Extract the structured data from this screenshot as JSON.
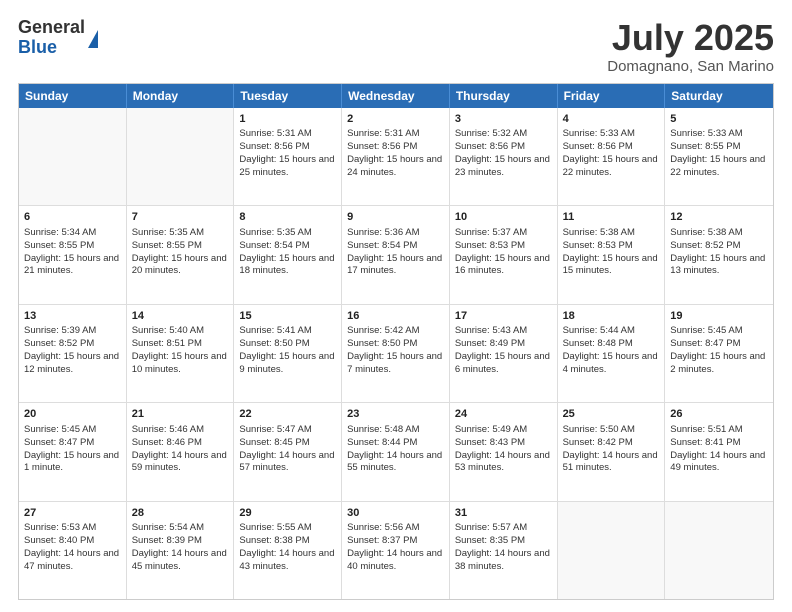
{
  "logo": {
    "general": "General",
    "blue": "Blue"
  },
  "title": "July 2025",
  "location": "Domagnano, San Marino",
  "weekdays": [
    "Sunday",
    "Monday",
    "Tuesday",
    "Wednesday",
    "Thursday",
    "Friday",
    "Saturday"
  ],
  "weeks": [
    [
      {
        "day": "",
        "sunrise": "",
        "sunset": "",
        "daylight": ""
      },
      {
        "day": "",
        "sunrise": "",
        "sunset": "",
        "daylight": ""
      },
      {
        "day": "1",
        "sunrise": "Sunrise: 5:31 AM",
        "sunset": "Sunset: 8:56 PM",
        "daylight": "Daylight: 15 hours and 25 minutes."
      },
      {
        "day": "2",
        "sunrise": "Sunrise: 5:31 AM",
        "sunset": "Sunset: 8:56 PM",
        "daylight": "Daylight: 15 hours and 24 minutes."
      },
      {
        "day": "3",
        "sunrise": "Sunrise: 5:32 AM",
        "sunset": "Sunset: 8:56 PM",
        "daylight": "Daylight: 15 hours and 23 minutes."
      },
      {
        "day": "4",
        "sunrise": "Sunrise: 5:33 AM",
        "sunset": "Sunset: 8:56 PM",
        "daylight": "Daylight: 15 hours and 22 minutes."
      },
      {
        "day": "5",
        "sunrise": "Sunrise: 5:33 AM",
        "sunset": "Sunset: 8:55 PM",
        "daylight": "Daylight: 15 hours and 22 minutes."
      }
    ],
    [
      {
        "day": "6",
        "sunrise": "Sunrise: 5:34 AM",
        "sunset": "Sunset: 8:55 PM",
        "daylight": "Daylight: 15 hours and 21 minutes."
      },
      {
        "day": "7",
        "sunrise": "Sunrise: 5:35 AM",
        "sunset": "Sunset: 8:55 PM",
        "daylight": "Daylight: 15 hours and 20 minutes."
      },
      {
        "day": "8",
        "sunrise": "Sunrise: 5:35 AM",
        "sunset": "Sunset: 8:54 PM",
        "daylight": "Daylight: 15 hours and 18 minutes."
      },
      {
        "day": "9",
        "sunrise": "Sunrise: 5:36 AM",
        "sunset": "Sunset: 8:54 PM",
        "daylight": "Daylight: 15 hours and 17 minutes."
      },
      {
        "day": "10",
        "sunrise": "Sunrise: 5:37 AM",
        "sunset": "Sunset: 8:53 PM",
        "daylight": "Daylight: 15 hours and 16 minutes."
      },
      {
        "day": "11",
        "sunrise": "Sunrise: 5:38 AM",
        "sunset": "Sunset: 8:53 PM",
        "daylight": "Daylight: 15 hours and 15 minutes."
      },
      {
        "day": "12",
        "sunrise": "Sunrise: 5:38 AM",
        "sunset": "Sunset: 8:52 PM",
        "daylight": "Daylight: 15 hours and 13 minutes."
      }
    ],
    [
      {
        "day": "13",
        "sunrise": "Sunrise: 5:39 AM",
        "sunset": "Sunset: 8:52 PM",
        "daylight": "Daylight: 15 hours and 12 minutes."
      },
      {
        "day": "14",
        "sunrise": "Sunrise: 5:40 AM",
        "sunset": "Sunset: 8:51 PM",
        "daylight": "Daylight: 15 hours and 10 minutes."
      },
      {
        "day": "15",
        "sunrise": "Sunrise: 5:41 AM",
        "sunset": "Sunset: 8:50 PM",
        "daylight": "Daylight: 15 hours and 9 minutes."
      },
      {
        "day": "16",
        "sunrise": "Sunrise: 5:42 AM",
        "sunset": "Sunset: 8:50 PM",
        "daylight": "Daylight: 15 hours and 7 minutes."
      },
      {
        "day": "17",
        "sunrise": "Sunrise: 5:43 AM",
        "sunset": "Sunset: 8:49 PM",
        "daylight": "Daylight: 15 hours and 6 minutes."
      },
      {
        "day": "18",
        "sunrise": "Sunrise: 5:44 AM",
        "sunset": "Sunset: 8:48 PM",
        "daylight": "Daylight: 15 hours and 4 minutes."
      },
      {
        "day": "19",
        "sunrise": "Sunrise: 5:45 AM",
        "sunset": "Sunset: 8:47 PM",
        "daylight": "Daylight: 15 hours and 2 minutes."
      }
    ],
    [
      {
        "day": "20",
        "sunrise": "Sunrise: 5:45 AM",
        "sunset": "Sunset: 8:47 PM",
        "daylight": "Daylight: 15 hours and 1 minute."
      },
      {
        "day": "21",
        "sunrise": "Sunrise: 5:46 AM",
        "sunset": "Sunset: 8:46 PM",
        "daylight": "Daylight: 14 hours and 59 minutes."
      },
      {
        "day": "22",
        "sunrise": "Sunrise: 5:47 AM",
        "sunset": "Sunset: 8:45 PM",
        "daylight": "Daylight: 14 hours and 57 minutes."
      },
      {
        "day": "23",
        "sunrise": "Sunrise: 5:48 AM",
        "sunset": "Sunset: 8:44 PM",
        "daylight": "Daylight: 14 hours and 55 minutes."
      },
      {
        "day": "24",
        "sunrise": "Sunrise: 5:49 AM",
        "sunset": "Sunset: 8:43 PM",
        "daylight": "Daylight: 14 hours and 53 minutes."
      },
      {
        "day": "25",
        "sunrise": "Sunrise: 5:50 AM",
        "sunset": "Sunset: 8:42 PM",
        "daylight": "Daylight: 14 hours and 51 minutes."
      },
      {
        "day": "26",
        "sunrise": "Sunrise: 5:51 AM",
        "sunset": "Sunset: 8:41 PM",
        "daylight": "Daylight: 14 hours and 49 minutes."
      }
    ],
    [
      {
        "day": "27",
        "sunrise": "Sunrise: 5:53 AM",
        "sunset": "Sunset: 8:40 PM",
        "daylight": "Daylight: 14 hours and 47 minutes."
      },
      {
        "day": "28",
        "sunrise": "Sunrise: 5:54 AM",
        "sunset": "Sunset: 8:39 PM",
        "daylight": "Daylight: 14 hours and 45 minutes."
      },
      {
        "day": "29",
        "sunrise": "Sunrise: 5:55 AM",
        "sunset": "Sunset: 8:38 PM",
        "daylight": "Daylight: 14 hours and 43 minutes."
      },
      {
        "day": "30",
        "sunrise": "Sunrise: 5:56 AM",
        "sunset": "Sunset: 8:37 PM",
        "daylight": "Daylight: 14 hours and 40 minutes."
      },
      {
        "day": "31",
        "sunrise": "Sunrise: 5:57 AM",
        "sunset": "Sunset: 8:35 PM",
        "daylight": "Daylight: 14 hours and 38 minutes."
      },
      {
        "day": "",
        "sunrise": "",
        "sunset": "",
        "daylight": ""
      },
      {
        "day": "",
        "sunrise": "",
        "sunset": "",
        "daylight": ""
      }
    ]
  ]
}
